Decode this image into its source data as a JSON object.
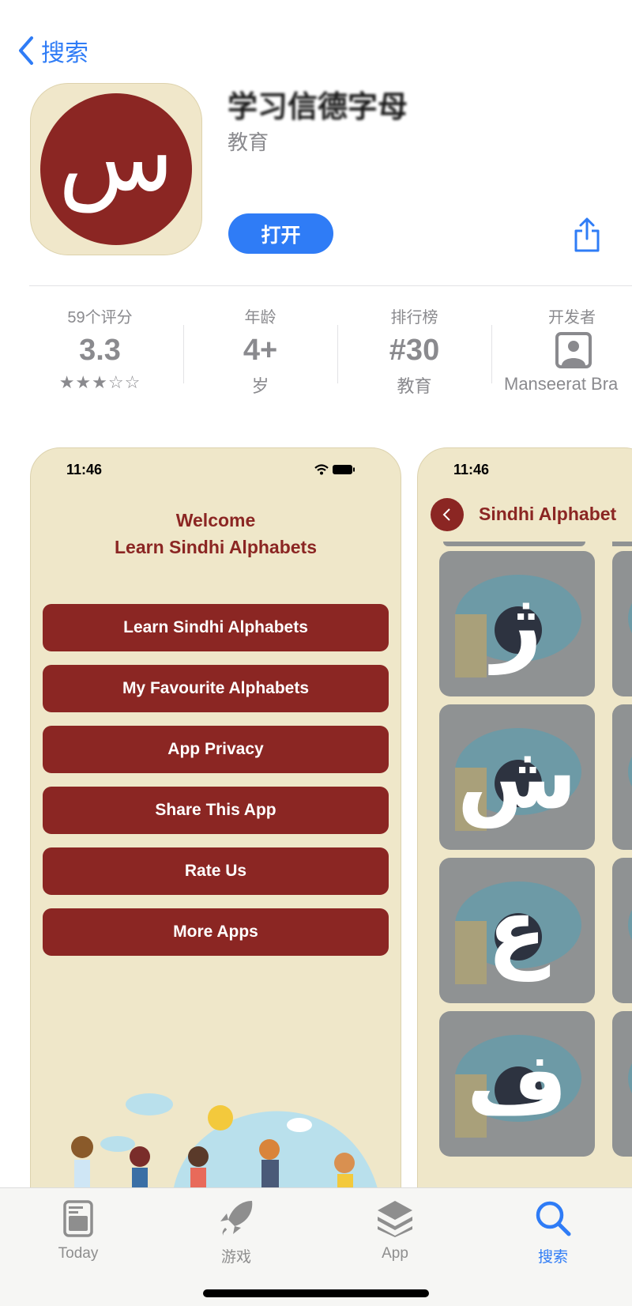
{
  "nav": {
    "back_label": "搜索"
  },
  "app": {
    "icon_letter": "س",
    "title": "学习信德字母",
    "category": "教育",
    "open_label": "打开"
  },
  "stats": [
    {
      "label": "59个评分",
      "value": "3.3",
      "sub": "★★★☆☆",
      "rating": 3.3
    },
    {
      "label": "年龄",
      "value": "4+",
      "sub": "岁"
    },
    {
      "label": "排行榜",
      "value": "#30",
      "sub": "教育"
    },
    {
      "label": "开发者",
      "sub": "Manseerat Bra"
    }
  ],
  "screenshot1": {
    "time": "11:46",
    "welcome_line1": "Welcome",
    "welcome_line2": "Learn Sindhi Alphabets",
    "menu": [
      "Learn Sindhi Alphabets",
      "My Favourite Alphabets",
      "App Privacy",
      "Share This App",
      "Rate Us",
      "More Apps"
    ]
  },
  "screenshot2": {
    "time": "11:46",
    "title": "Sindhi Alphabet",
    "letters": [
      "ژ",
      "ش",
      "ع",
      "ف"
    ]
  },
  "tabs": [
    {
      "label": "Today",
      "icon": "today-icon"
    },
    {
      "label": "游戏",
      "icon": "rocket-icon"
    },
    {
      "label": "App",
      "icon": "layers-icon"
    },
    {
      "label": "搜索",
      "icon": "search-icon",
      "active": true
    }
  ],
  "colors": {
    "accent": "#2f7cf6",
    "brand": "#8b2623",
    "card_bg": "#efe7c9"
  }
}
